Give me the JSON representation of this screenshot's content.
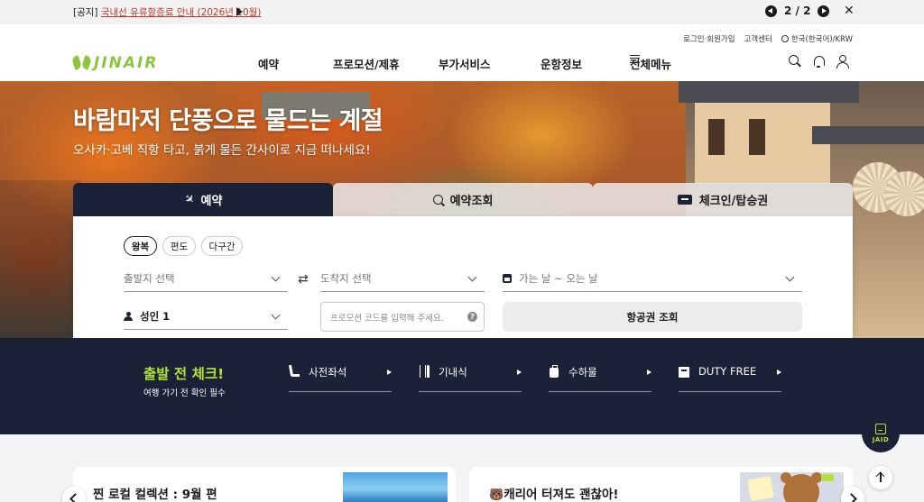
{
  "notice": {
    "tag": "[공지]",
    "title": "국내선 유류할증료 안내 (2026년 10월)",
    "pager": "2 / 2"
  },
  "header": {
    "util_links": [
      "로그인·회원가입",
      "고객센터",
      "한국(한국어)/KRW"
    ],
    "logo_text": "JINAIR",
    "nav": [
      "예약",
      "프로모션/제휴",
      "부가서비스",
      "운항정보",
      "전체메뉴"
    ]
  },
  "hero": {
    "title": "바람마저 단풍으로 물드는 계절",
    "subtitle": "오사카·고베 직항 타고, 붉게 물든 간사이로 지금 떠나세요!"
  },
  "booking": {
    "tabs": [
      "예약",
      "예약조회",
      "체크인/탑승권"
    ],
    "trip_types": [
      "왕복",
      "편도",
      "다구간"
    ],
    "origin_placeholder": "출발지 선택",
    "destination_placeholder": "도착지 선택",
    "dates_placeholder": "가는 날 ~ 오는 날",
    "passengers": "성인 1",
    "promo_placeholder": "프로모션 코드를 입력해 주세요.",
    "promo_help": "?",
    "search_button": "항공권 조회"
  },
  "departure_check": {
    "title": "출발 전 체크!",
    "subtitle": "여행 가기 전 확인 필수",
    "items": [
      "사전좌석",
      "기내식",
      "수하물",
      "DUTY FREE"
    ]
  },
  "chatbot": {
    "label": "JAID"
  },
  "cards": [
    {
      "title": "찐 로컬 컬렉션 : 9월 편"
    },
    {
      "title": "캐리어 터져도 괜찮아!",
      "emoji": "🐻"
    }
  ],
  "colors": {
    "navy": "#1b2238",
    "lime": "#b5e23a",
    "logo_green": "#8cc63f",
    "notice_link": "#c0392b"
  }
}
